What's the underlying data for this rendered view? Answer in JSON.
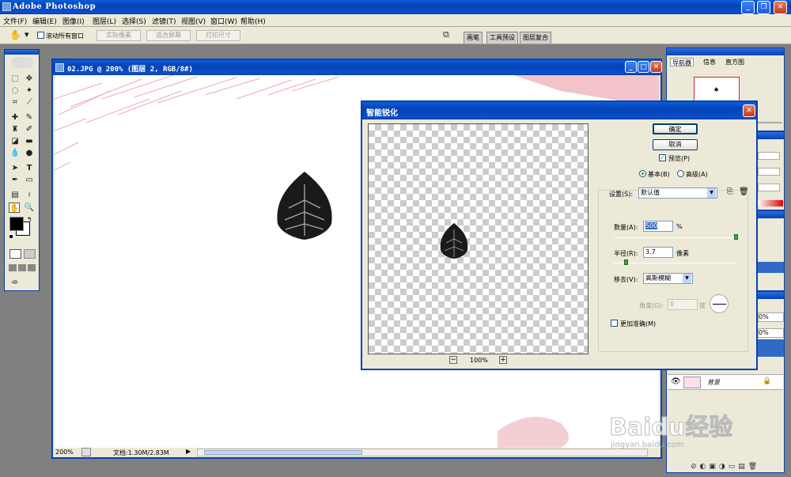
{
  "app": {
    "title": "Adobe Photoshop"
  },
  "menu": [
    "文件(F)",
    "编辑(E)",
    "图像(I)",
    "图层(L)",
    "选择(S)",
    "滤镜(T)",
    "视图(V)",
    "窗口(W)",
    "帮助(H)"
  ],
  "options_bar": {
    "scroll_all_label": "滚动所有窗口",
    "actual_pixels": "实际像素",
    "fit_screen": "适合屏幕",
    "print_size": "打印尺寸",
    "palette_tabs": [
      "画笔",
      "工具预设",
      "图层复合"
    ]
  },
  "document": {
    "title": "02.JPG @ 200% (图层 2, RGB/8#)",
    "zoom": "200%",
    "doc_info": "文档:1.30M/2.83M"
  },
  "dialog": {
    "title": "智能锐化",
    "ok": "确定",
    "cancel": "取消",
    "preview": "预览(P)",
    "basic": "基本(B)",
    "advanced": "高级(A)",
    "settings_label": "设置(S):",
    "settings_value": "默认值",
    "amount_label": "数量(A):",
    "amount_value": "500",
    "amount_unit": "%",
    "radius_label": "半径(R):",
    "radius_value": "3.7",
    "radius_unit": "像素",
    "remove_label": "移去(V):",
    "remove_value": "高斯模糊",
    "angle_label": "角度(G):",
    "angle_value": "0",
    "angle_unit": "度",
    "more_accurate": "更加准确(M)",
    "preview_zoom": "100%"
  },
  "palettes": {
    "navigator_tabs": [
      "导航器",
      "信息",
      "直方图"
    ],
    "layer_name": "背景"
  },
  "watermark": {
    "brand": "Baidu经验",
    "url": "jingyan.baidu.com"
  }
}
